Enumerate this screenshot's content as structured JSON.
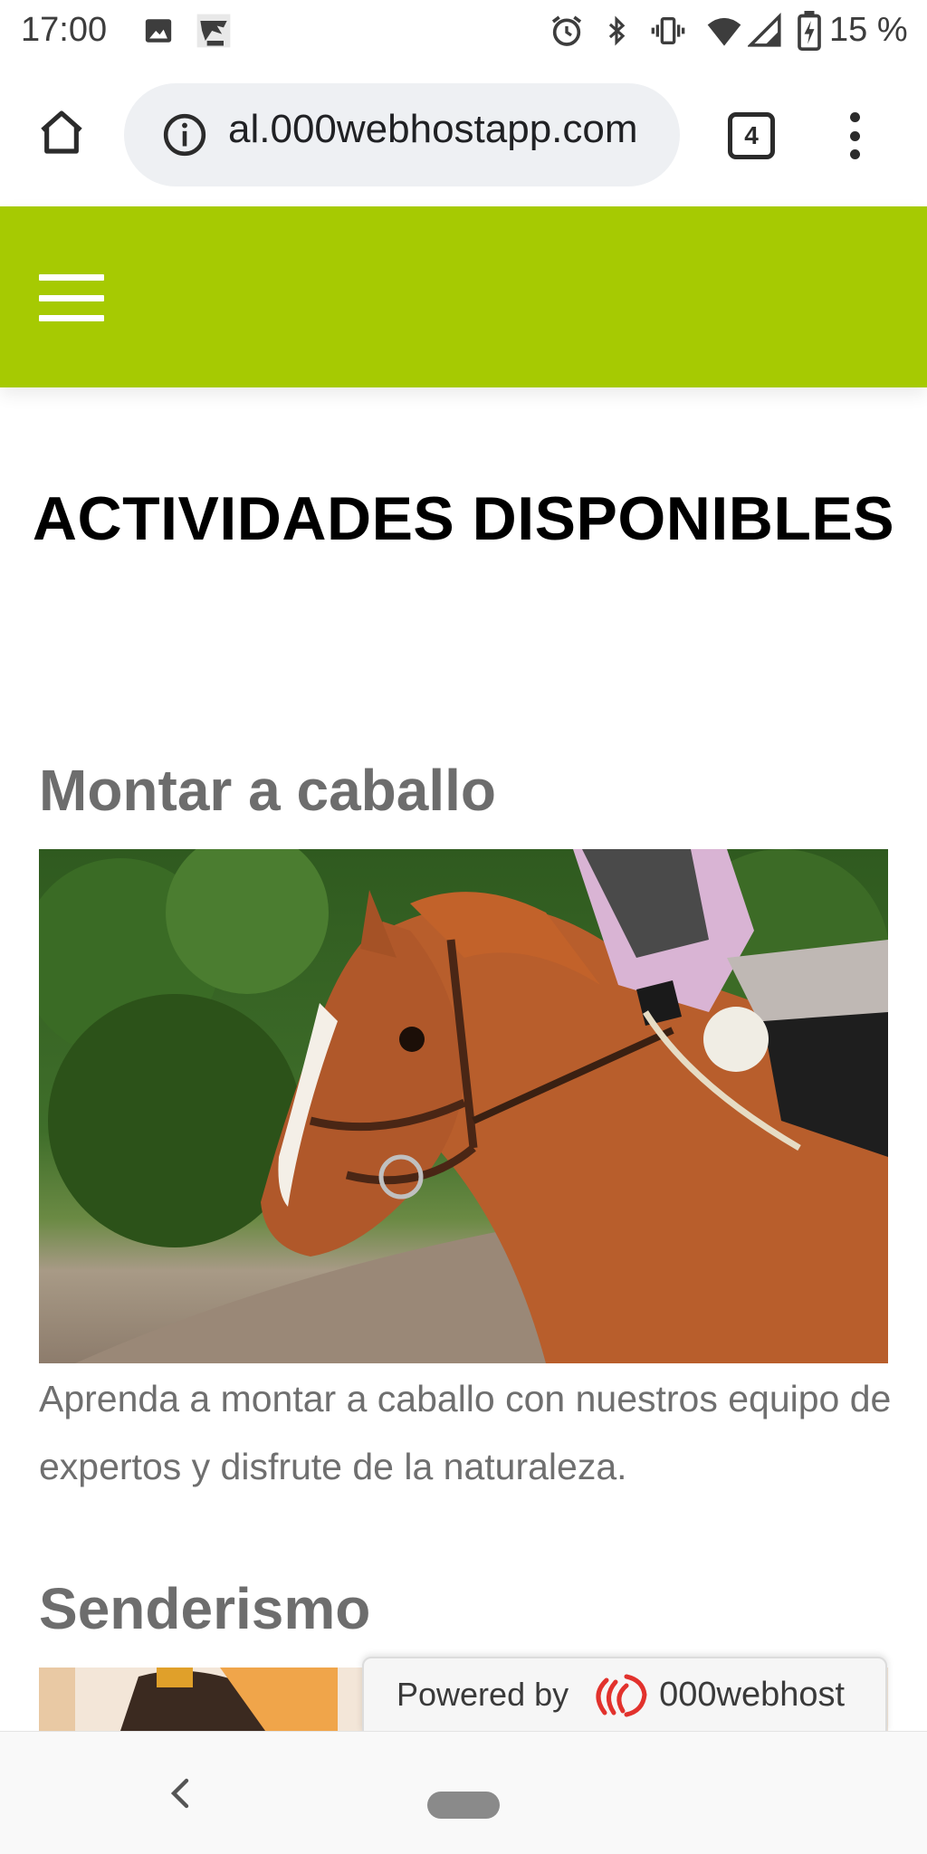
{
  "status_bar": {
    "time": "17:00",
    "battery_percent": "15 %",
    "icons": [
      "image-icon",
      "app-notification-icon",
      "alarm-icon",
      "bluetooth-icon",
      "vibrate-icon",
      "wifi-icon",
      "signal-icon",
      "battery-charging-icon"
    ]
  },
  "browser": {
    "url": "al.000webhostapp.com",
    "tab_count": "4",
    "icons": [
      "home-icon",
      "info-icon",
      "more-vert-icon"
    ]
  },
  "site": {
    "header_color": "#a6ca02",
    "page_title": "ACTIVIDADES DISPONIBLES",
    "activities": [
      {
        "title": "Montar a caballo",
        "description": "Aprenda a montar a caballo con nuestros equipo de expertos y disfrute de la naturaleza."
      },
      {
        "title": "Senderismo"
      }
    ]
  },
  "badge": {
    "label": "Powered by",
    "brand": "000webhost"
  },
  "nav": {
    "icons": [
      "back-icon",
      "home-pill-icon"
    ]
  }
}
